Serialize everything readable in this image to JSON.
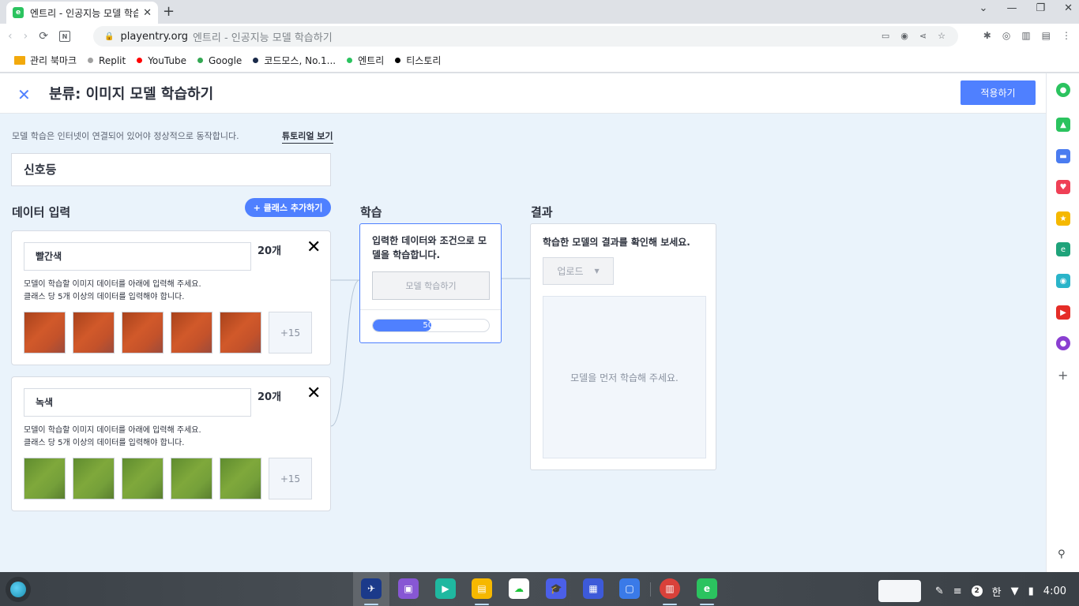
{
  "browser": {
    "tab_title": "엔트리 - 인공지능 모델 학습하기",
    "tab_favicon": "e",
    "url_host": "playentry.org",
    "url_page_title": "엔트리 - 인공지능 모델 학습하기",
    "bookmarks": [
      {
        "label": "관리 북마크",
        "icon": "folder-icon",
        "color": "#f2a90c"
      },
      {
        "label": "Replit",
        "icon": "replit-icon",
        "color": "#a0a0a0"
      },
      {
        "label": "YouTube",
        "icon": "youtube-icon",
        "color": "#ff0000"
      },
      {
        "label": "Google",
        "icon": "google-icon",
        "color": "#34a853"
      },
      {
        "label": "코드모스, No.1...",
        "icon": "codemos-icon",
        "color": "#1a2a4a"
      },
      {
        "label": "엔트리",
        "icon": "entry-icon",
        "color": "#2bc35f"
      },
      {
        "label": "티스토리",
        "icon": "tistory-icon",
        "color": "#000000"
      }
    ]
  },
  "app": {
    "title": "분류: 이미지 모델 학습하기",
    "apply_label": "적용하기",
    "notice": "모델 학습은 인터넷이 연결되어 있어야 정상적으로 동작합니다.",
    "tutorial_label": "튜토리얼 보기",
    "model_name": "신호등",
    "data_input_title": "데이터 입력",
    "add_class_label": "+ 클래스 추가하기",
    "classes": [
      {
        "name": "빨간색",
        "count": "20개",
        "desc_line1": "모델이 학습할 이미지 데이터를 아래에 입력해 주세요.",
        "desc_line2": "클래스 당 5개 이상의 데이터를 입력해야 합니다.",
        "more": "+15"
      },
      {
        "name": "녹색",
        "count": "20개",
        "desc_line1": "모델이 학습할 이미지 데이터를 아래에 입력해 주세요.",
        "desc_line2": "클래스 당 5개 이상의 데이터를 입력해야 합니다.",
        "more": "+15"
      }
    ],
    "train": {
      "title": "학습",
      "desc": "입력한 데이터와 조건으로 모델을 학습합니다.",
      "button_label": "모델 학습하기",
      "progress_text": "50%",
      "progress_value": 0.5
    },
    "result": {
      "title": "결과",
      "desc": "학습한 모델의 결과를 확인해 보세요.",
      "upload_label": "업로드",
      "placeholder": "모델을 먼저 학습해 주세요."
    }
  },
  "shelf": {
    "tray_badge": "2",
    "ime": "한",
    "time": "4:00"
  },
  "colors": {
    "accent": "#4f80ff",
    "workspace_bg": "#eaf3fb"
  }
}
